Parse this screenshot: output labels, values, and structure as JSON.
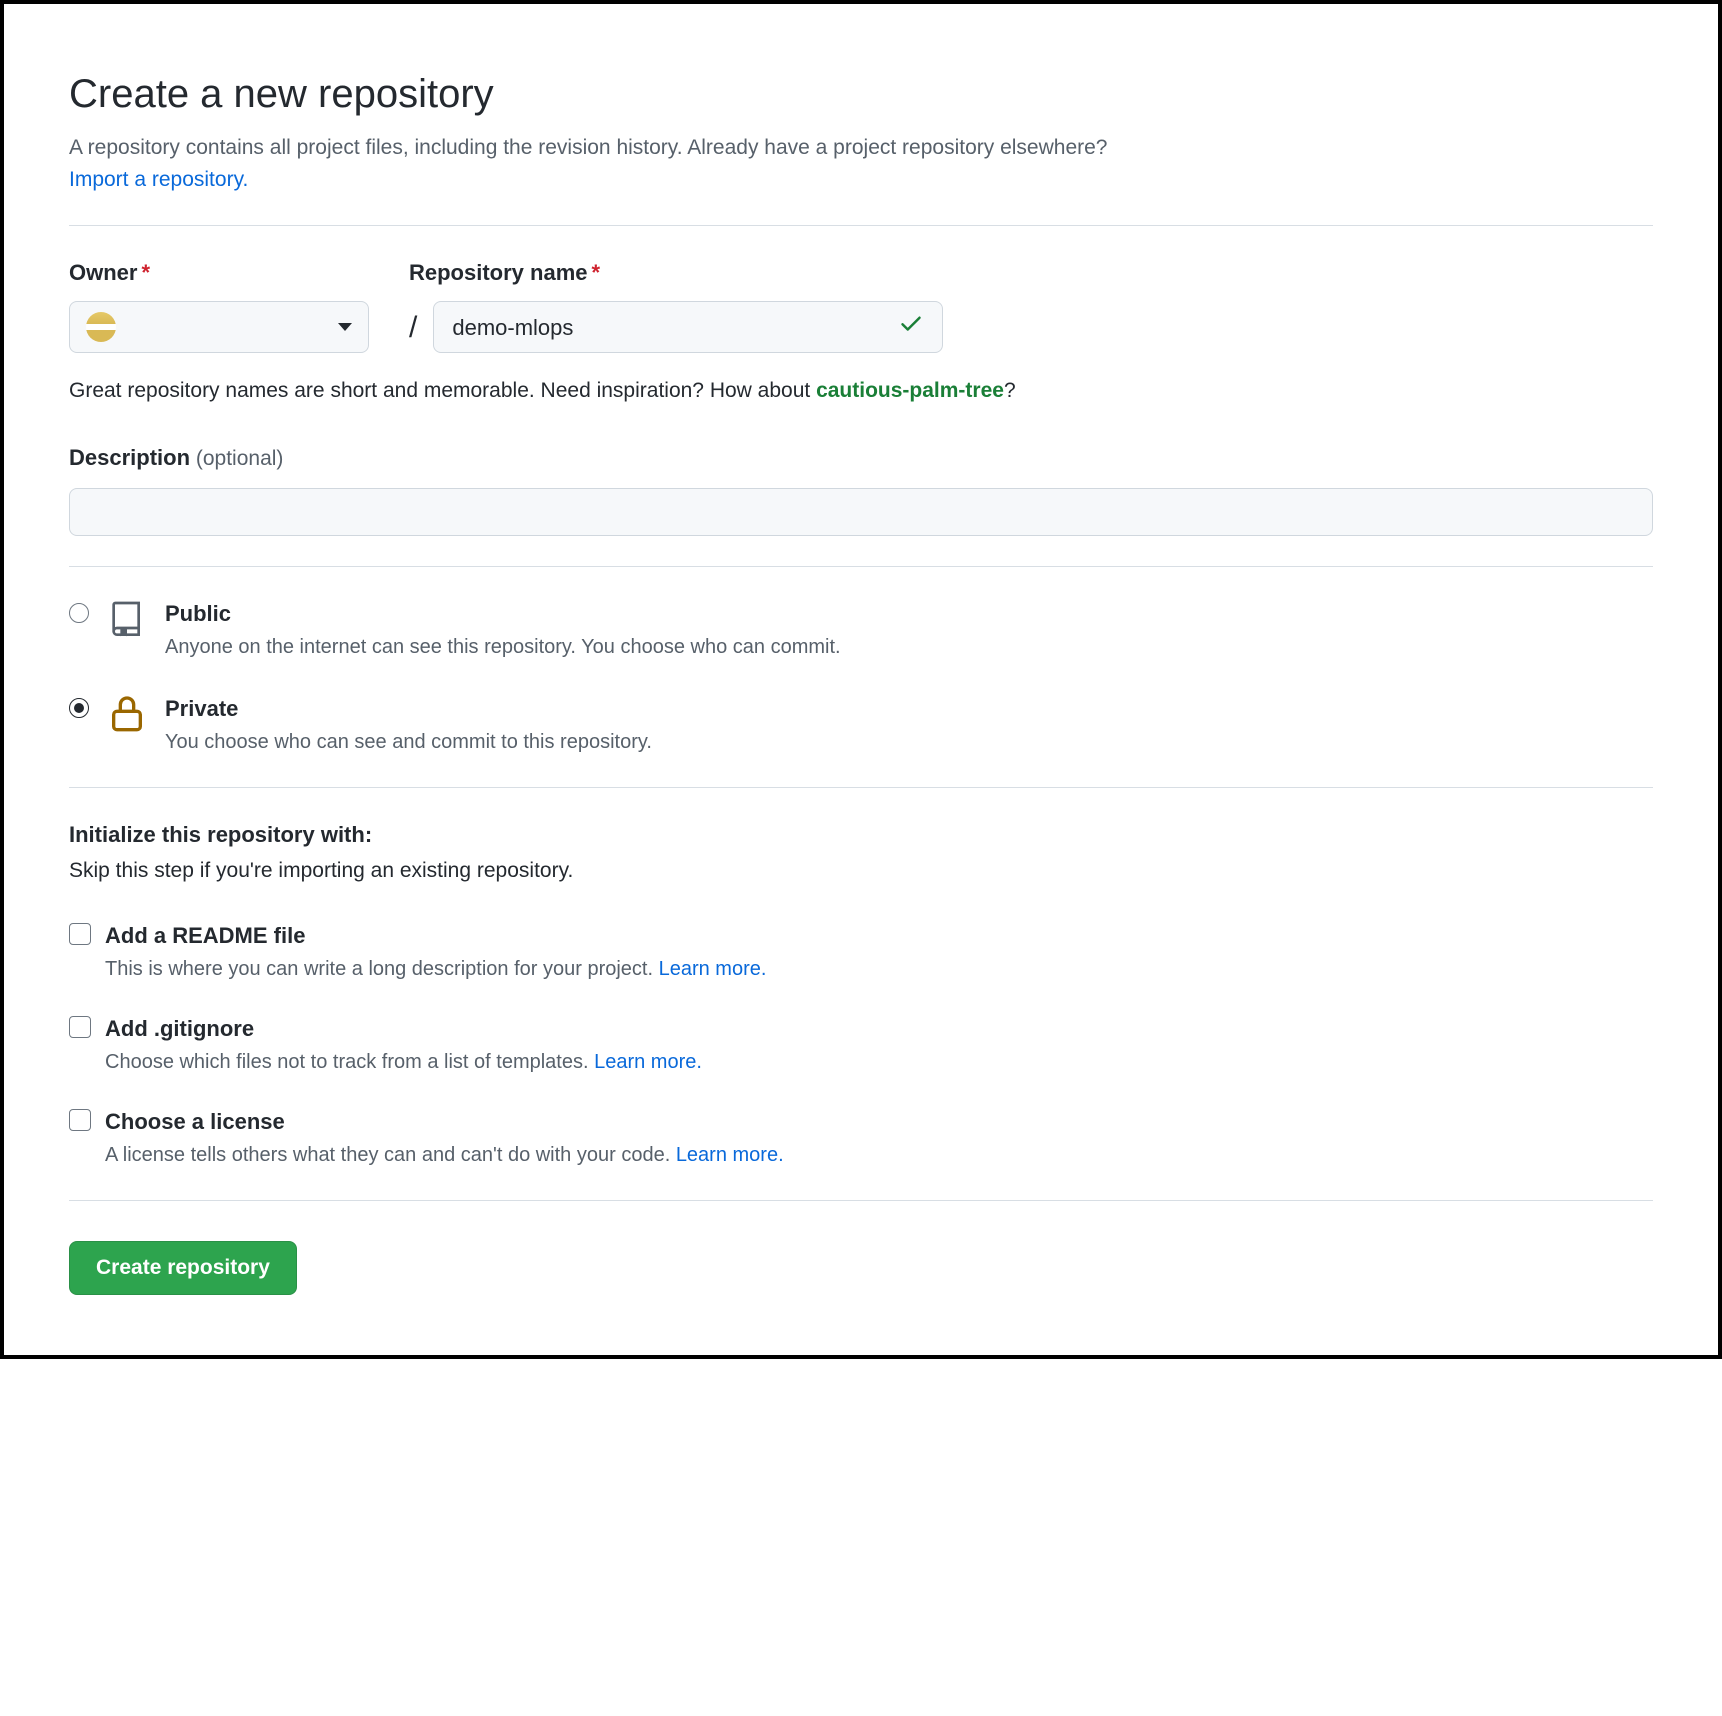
{
  "header": {
    "title": "Create a new repository",
    "subtitle_part1": "A repository contains all project files, including the revision history. Already have a project repository elsewhere? ",
    "import_link": "Import a repository."
  },
  "owner": {
    "label": "Owner"
  },
  "repo_name": {
    "label": "Repository name",
    "value": "demo-mlops"
  },
  "hint": {
    "prefix": "Great repository names are short and memorable. Need inspiration? How about ",
    "suggestion": "cautious-palm-tree",
    "suffix": "?"
  },
  "description": {
    "label": "Description",
    "optional": "(optional)",
    "value": ""
  },
  "visibility": {
    "public": {
      "title": "Public",
      "desc": "Anyone on the internet can see this repository. You choose who can commit."
    },
    "private": {
      "title": "Private",
      "desc": "You choose who can see and commit to this repository."
    }
  },
  "initialize": {
    "heading": "Initialize this repository with:",
    "subtext": "Skip this step if you're importing an existing repository.",
    "readme": {
      "title": "Add a README file",
      "desc": "This is where you can write a long description for your project. ",
      "learn_more": "Learn more."
    },
    "gitignore": {
      "title": "Add .gitignore",
      "desc": "Choose which files not to track from a list of templates. ",
      "learn_more": "Learn more."
    },
    "license": {
      "title": "Choose a license",
      "desc": "A license tells others what they can and can't do with your code. ",
      "learn_more": "Learn more."
    }
  },
  "submit": {
    "label": "Create repository"
  }
}
